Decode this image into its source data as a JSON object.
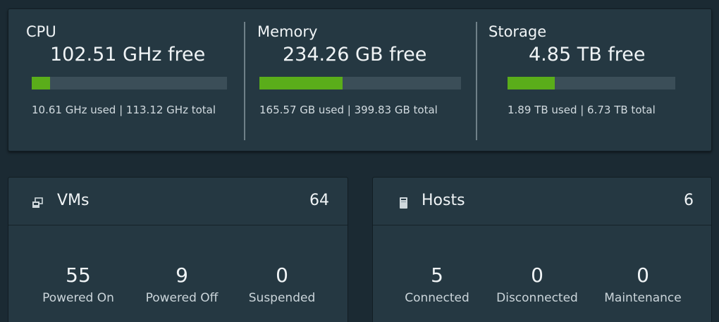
{
  "capacity": {
    "cpu": {
      "title": "CPU",
      "free": "102.51 GHz free",
      "detail": "10.61 GHz used | 113.12 GHz total",
      "used_fraction": 0.094
    },
    "memory": {
      "title": "Memory",
      "free": "234.26 GB free",
      "detail": "165.57 GB used | 399.83 GB total",
      "used_fraction": 0.414
    },
    "storage": {
      "title": "Storage",
      "free": "4.85 TB free",
      "detail": "1.89 TB used | 6.73 TB total",
      "used_fraction": 0.281
    }
  },
  "vms": {
    "title": "VMs",
    "count": "64",
    "icon": "vm-icon",
    "stats": [
      {
        "value": "55",
        "label": "Powered On"
      },
      {
        "value": "9",
        "label": "Powered Off"
      },
      {
        "value": "0",
        "label": "Suspended"
      }
    ]
  },
  "hosts": {
    "title": "Hosts",
    "count": "6",
    "icon": "host-icon",
    "stats": [
      {
        "value": "5",
        "label": "Connected"
      },
      {
        "value": "0",
        "label": "Disconnected"
      },
      {
        "value": "0",
        "label": "Maintenance"
      }
    ]
  },
  "colors": {
    "background": "#1b2a33",
    "panel": "#253842",
    "bar_track": "#3b4e58",
    "bar_fill": "#5aad1a"
  }
}
